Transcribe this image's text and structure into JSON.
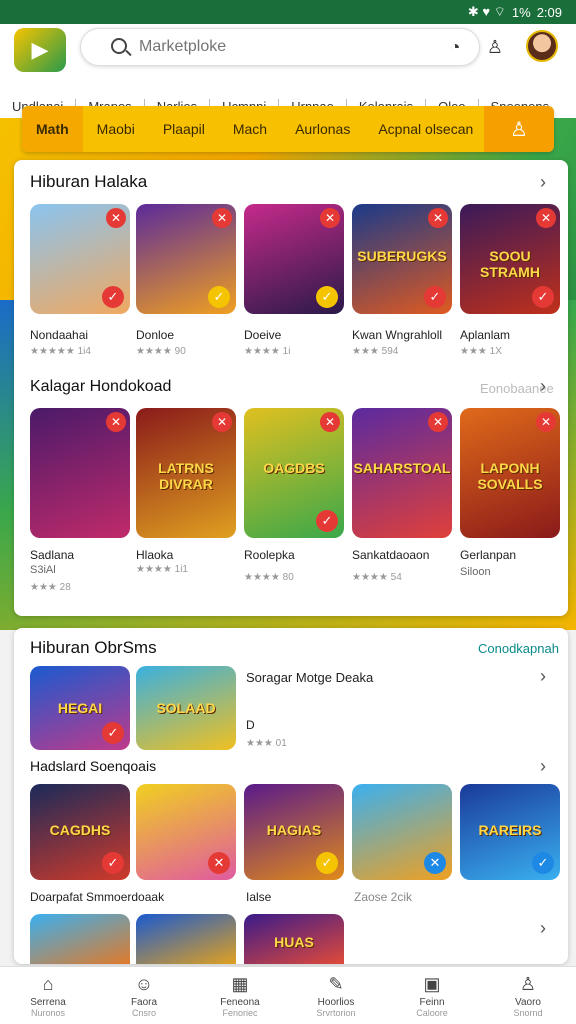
{
  "status": {
    "icons": "✱ ♥ ⌔",
    "battery": "1%",
    "time": "2:09"
  },
  "header": {
    "search_placeholder": "Marketploke"
  },
  "navtabs": [
    "Undlanai",
    "Mrapos",
    "Narlies",
    "Ucmnni",
    "Hrnnae",
    "Kelonrais",
    "Oleo",
    "Sneenens"
  ],
  "categories": {
    "items": [
      "Math",
      "Maobi",
      "Plaapil",
      "Mach",
      "Aurlonas",
      "Acpnal olsecan"
    ]
  },
  "section1": {
    "title": "Hiburan Halaka",
    "games": [
      {
        "name": "Nondaahai",
        "rating": "★★★★★ 1i4",
        "word": "",
        "bg": "linear-gradient(160deg,#8ac4f0,#f0a860)"
      },
      {
        "name": "Donloe",
        "rating": "★★★★ 90",
        "word": "",
        "bg": "linear-gradient(160deg,#5b2a9a,#f0a020)"
      },
      {
        "name": "Doeive",
        "rating": "★★★★ 1i",
        "word": "",
        "bg": "linear-gradient(160deg,#c52a8a,#2a1a4a)"
      },
      {
        "name": "Kwan Wngrahloll",
        "rating": "★★★ 594",
        "word": "SUBERUGKS",
        "bg": "linear-gradient(160deg,#1a3a8a,#e05a20)"
      },
      {
        "name": "Aplanlam",
        "rating": "★★★ 1X",
        "word": "SOOU STRAMH",
        "bg": "linear-gradient(160deg,#3a1a5a,#c0301a)"
      }
    ]
  },
  "section2": {
    "title": "Kalagar Hondokoad",
    "link": "Eonobaanee",
    "games": [
      {
        "name": "Sadlana",
        "sub": "S3iAl",
        "rating": "★★★ 28",
        "word": "",
        "bg": "linear-gradient(160deg,#4a1a6a,#c02a6a)"
      },
      {
        "name": "Hlaoka",
        "rating": "★★★★ 1i1",
        "word": "LATRNS DIVRAR",
        "bg": "linear-gradient(160deg,#8a1a1a,#e0a020)"
      },
      {
        "name": "Roolepka",
        "rating": "★★★★ 80",
        "word": "OAGDBS",
        "bg": "linear-gradient(160deg,#e0c020,#3aa84a)"
      },
      {
        "name": "Sankatdaoaon",
        "rating": "★★★★ 54",
        "word": "SAHARSTOAL",
        "bg": "linear-gradient(160deg,#5a2aa0,#e0403a)"
      },
      {
        "name": "Gerlanpan",
        "sub": "Siloon",
        "rating": "",
        "word": "LAPONH SOVALLS",
        "bg": "linear-gradient(160deg,#e06a1a,#8a1a1a)"
      }
    ]
  },
  "section3": {
    "title": "Hiburan ObrSms",
    "link": "Conodkapnah",
    "featured": {
      "title": "Soragar Motge Deaka",
      "d": "D",
      "rating": "★★★ 01"
    },
    "tiles": [
      {
        "word": "HEGAI",
        "bg": "linear-gradient(160deg,#1a5ad0,#c03a8a)"
      },
      {
        "word": "SOLAAD",
        "bg": "linear-gradient(160deg,#3ab0e0,#f0c020)"
      }
    ],
    "subtitle": "Hadslard Soenqoais",
    "games2": [
      {
        "word": "CAGDHS",
        "bg": "linear-gradient(160deg,#1a2a5a,#d03a2a)"
      },
      {
        "word": "",
        "bg": "linear-gradient(160deg,#f0d020,#e05aa0)"
      },
      {
        "word": "HAGIAS",
        "bg": "linear-gradient(160deg,#5a1a8a,#e08a1a)"
      },
      {
        "word": "",
        "bg": "linear-gradient(160deg,#3ab0f0,#f0a020)"
      },
      {
        "word": "RAREIRS",
        "bg": "linear-gradient(160deg,#1a3a9a,#3ab0f0)"
      }
    ],
    "names2": [
      {
        "name": "Doarpafat Smmoerdoaak"
      },
      {
        "name": "Ialse"
      },
      {
        "name": "Zaose 2cik"
      }
    ],
    "games3": [
      {
        "word": "",
        "bg": "linear-gradient(160deg,#3ab0f0,#e07a2a)"
      },
      {
        "word": "",
        "bg": "linear-gradient(160deg,#1a5ad0,#e0a020)"
      },
      {
        "word": "HUAS",
        "bg": "linear-gradient(160deg,#3a1a8a,#e04a3a)"
      }
    ]
  },
  "bottomnav": [
    {
      "icon": "⌂",
      "l1": "Serrena",
      "l2": "Nuronos"
    },
    {
      "icon": "☺",
      "l1": "Faora",
      "l2": "Cnsro"
    },
    {
      "icon": "▦",
      "l1": "Feneona",
      "l2": "Fenoriec"
    },
    {
      "icon": "✎",
      "l1": "Hoorlios",
      "l2": "Srvrtorion"
    },
    {
      "icon": "▣",
      "l1": "Feinn",
      "l2": "Caloore"
    },
    {
      "icon": "♙",
      "l1": "Vaoro",
      "l2": "Snornd"
    }
  ]
}
